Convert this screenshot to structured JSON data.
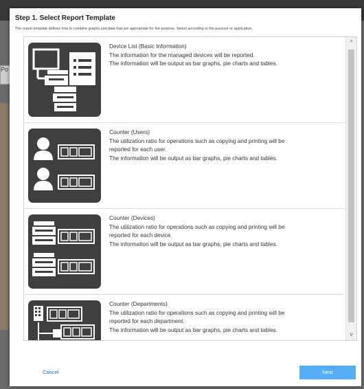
{
  "dialog": {
    "title": "Step 1. Select Report Template",
    "description": "The report template defines how to combine graphs and data that are appropriate for the purpose. Select according to the purpose or application."
  },
  "background": {
    "partial_label": "Po"
  },
  "templates": [
    {
      "name": "Device List (Basic Information)",
      "lines": [
        "The information for the managed devices will be reported.",
        "The information will be output as bar graphs, pie charts and tables."
      ],
      "icon": "device-list-icon"
    },
    {
      "name": "Counter (Users)",
      "lines": [
        "The utilization ratio for operations such as copying and printing will be",
        "reported for each user.",
        "The information will be output as bar graphs, pie charts and tables."
      ],
      "icon": "user-counter-icon",
      "counter_digits": "00 4"
    },
    {
      "name": "Counter (Devices)",
      "lines": [
        "The utilization ratio for operations such as copying and printing will be",
        "reported for each device.",
        "The information will be output as bar graphs, pie charts and tables."
      ],
      "icon": "device-counter-icon",
      "counter_digits": "00 4"
    },
    {
      "name": "Counter (Departments)",
      "lines": [
        "The utilization ratio for operations such as copying and printing will be",
        "reported for each department.",
        "The information will be output as bar graphs, pie charts and tables."
      ],
      "icon": "department-counter-icon",
      "counter_digits": "00 4"
    }
  ],
  "scrollbar": {
    "up_icon": "chevron-up-icon",
    "down_icon": "chevron-down-icon",
    "up_glyph": "^",
    "down_glyph": "v"
  },
  "footer": {
    "cancel_label": "Cancel",
    "next_label": "Next"
  },
  "colors": {
    "accent": "#58aef4",
    "link": "#2d6db5",
    "thumbnail_bg": "#3f3f3f"
  }
}
